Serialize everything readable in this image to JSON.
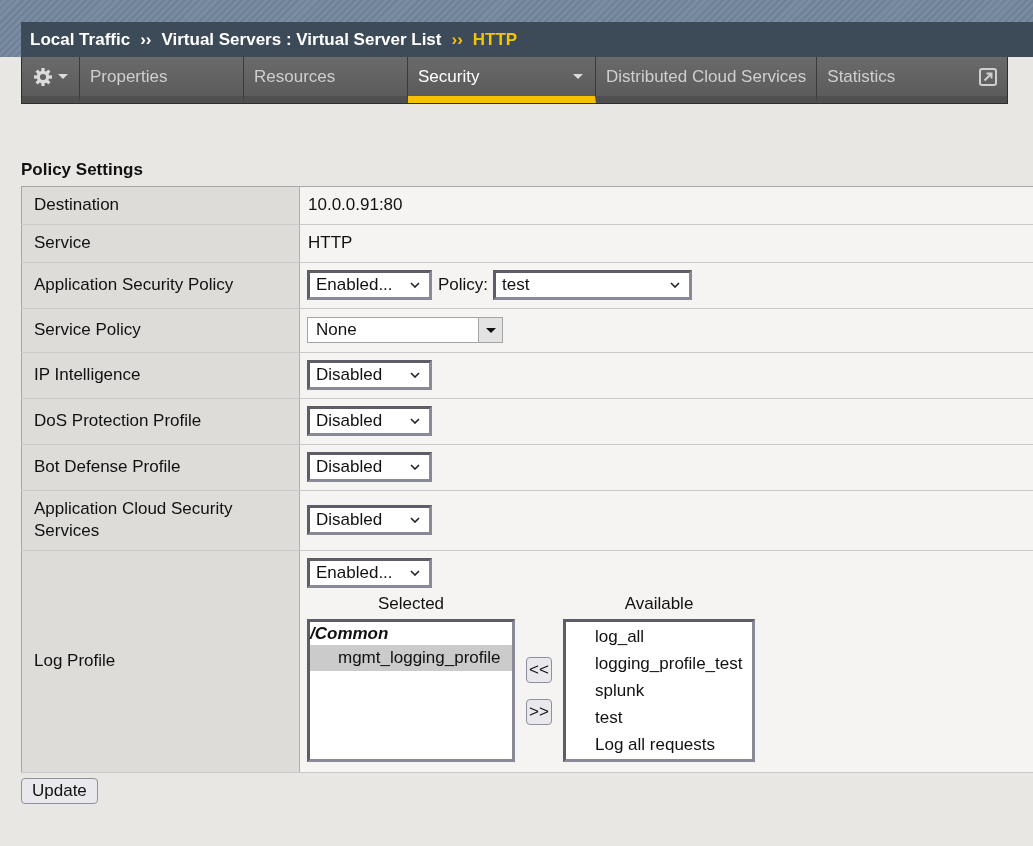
{
  "breadcrumb": [
    {
      "text": "Local Traffic",
      "current": false
    },
    {
      "separator": "››",
      "text": "Virtual Servers : Virtual Server List",
      "current": false
    },
    {
      "separator": "››",
      "text": "HTTP",
      "current": true
    }
  ],
  "tabs": [
    {
      "kind": "settings",
      "has_menu": true,
      "popout": false,
      "selected": false
    },
    {
      "kind": "tab",
      "label": "Properties",
      "has_menu": false,
      "popout": false,
      "selected": false
    },
    {
      "kind": "tab",
      "label": "Resources",
      "has_menu": false,
      "popout": false,
      "selected": false
    },
    {
      "kind": "tab",
      "label": "Security",
      "has_menu": true,
      "popout": false,
      "selected": true
    },
    {
      "kind": "tab",
      "label": "Distributed Cloud Services",
      "has_menu": false,
      "popout": false,
      "selected": false
    },
    {
      "kind": "tab",
      "label": "Statistics",
      "has_menu": false,
      "popout": true,
      "selected": false
    }
  ],
  "section_title": "Policy Settings",
  "rows": [
    {
      "kind": "text",
      "label": "Destination",
      "value": "10.0.0.91:80"
    },
    {
      "kind": "text",
      "label": "Service",
      "value": "HTTP"
    },
    {
      "kind": "select_policy",
      "label": "Application Security Policy",
      "value": "Enabled...",
      "policy_label": "Policy:",
      "policy": "test"
    },
    {
      "kind": "combo",
      "label": "Service Policy",
      "value": "None"
    },
    {
      "kind": "select",
      "label": "IP Intelligence",
      "value": "Disabled"
    },
    {
      "kind": "select",
      "label": "DoS Protection Profile",
      "value": "Disabled"
    },
    {
      "kind": "select",
      "label": "Bot Defense Profile",
      "value": "Disabled"
    },
    {
      "kind": "select",
      "label": "Application Cloud Security Services",
      "value": "Disabled"
    },
    {
      "kind": "log_profile",
      "label": "Log Profile",
      "value": "Enabled...",
      "selected_list": {
        "heading": "Selected",
        "groups": [
          {
            "name": "/Common",
            "children": [
              {
                "text": "mgmt_logging_profile",
                "selected": true
              }
            ]
          }
        ]
      },
      "move_buttons": [
        "<<",
        ">>"
      ],
      "available_list": {
        "heading": "Available",
        "items": [
          {
            "text": "log_all",
            "selected": false
          },
          {
            "text": "logging_profile_test",
            "selected": false
          },
          {
            "text": "splunk",
            "selected": false
          },
          {
            "text": "test",
            "selected": false
          },
          {
            "text": "Log all requests",
            "selected": false
          }
        ]
      }
    }
  ],
  "buttons": [
    "Update"
  ]
}
